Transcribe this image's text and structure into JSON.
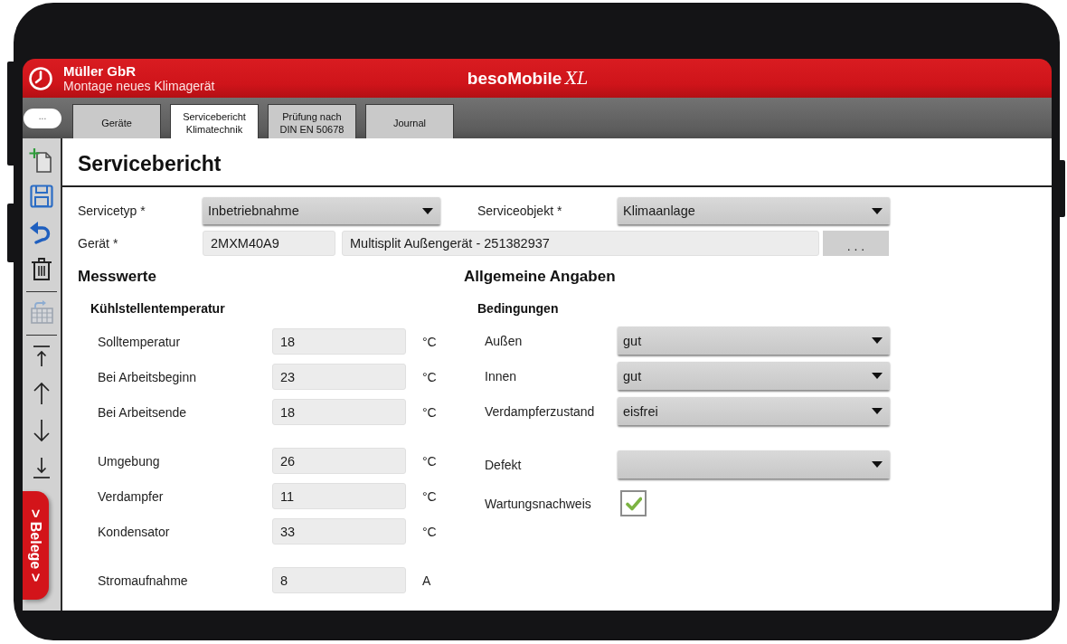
{
  "header": {
    "company": "Müller GbR",
    "subtitle": "Montage neues Klimagerät",
    "brand": "besoMobile",
    "brand_suffix": "XL"
  },
  "tab_bar": {
    "menu_button": "...",
    "tabs": [
      {
        "lines": [
          "Geräte"
        ],
        "selected": false
      },
      {
        "lines": [
          "Servicebericht",
          "Klimatechnik"
        ],
        "selected": true
      },
      {
        "lines": [
          "Prüfung nach",
          "DIN EN 50678"
        ],
        "selected": false
      },
      {
        "lines": [
          "Journal"
        ],
        "selected": false
      }
    ]
  },
  "toolbar": {
    "groups": [
      [
        {
          "kind": "new_document",
          "disabled": false
        },
        {
          "kind": "save",
          "disabled": false
        },
        {
          "kind": "undo",
          "disabled": false
        },
        {
          "kind": "delete",
          "disabled": false
        }
      ],
      [
        {
          "kind": "calendar",
          "disabled": true
        }
      ],
      [
        {
          "kind": "first",
          "disabled": false
        },
        {
          "kind": "up",
          "disabled": false
        },
        {
          "kind": "down",
          "disabled": false
        },
        {
          "kind": "last",
          "disabled": false
        }
      ]
    ]
  },
  "side_drawer": {
    "label": "> Belege >"
  },
  "form": {
    "title": "Servicebericht",
    "service_type": {
      "label": "Servicetyp *",
      "value": "Inbetriebnahme"
    },
    "service_object": {
      "label": "Serviceobjekt *",
      "value": "Klimaanlage"
    },
    "device": {
      "label": "Gerät *",
      "code": "2MXM40A9",
      "description": "Multisplit Außengerät - 251382937",
      "lookup_button": ". . ."
    }
  },
  "measurements": {
    "title": "Messwerte",
    "subtitle": "Kühlstellentemperatur",
    "groups": [
      {
        "rows": [
          {
            "label": "Solltemperatur",
            "value": "18",
            "unit": "°C"
          },
          {
            "label": "Bei Arbeitsbeginn",
            "value": "23",
            "unit": "°C"
          },
          {
            "label": "Bei Arbeitsende",
            "value": "18",
            "unit": "°C"
          }
        ]
      },
      {
        "rows": [
          {
            "label": "Umgebung",
            "value": "26",
            "unit": "°C"
          },
          {
            "label": "Verdampfer",
            "value": "11",
            "unit": "°C"
          },
          {
            "label": "Kondensator",
            "value": "33",
            "unit": "°C"
          }
        ]
      },
      {
        "rows": [
          {
            "label": "Stromaufnahme",
            "value": "8",
            "unit": "A"
          }
        ]
      }
    ]
  },
  "general": {
    "title": "Allgemeine Angaben",
    "subtitle": "Bedingungen",
    "groups": [
      {
        "rows": [
          {
            "kind": "dropdown",
            "label": "Außen",
            "value": "gut"
          },
          {
            "kind": "dropdown",
            "label": "Innen",
            "value": "gut"
          },
          {
            "kind": "dropdown",
            "label": "Verdampferzustand",
            "value": "eisfrei"
          }
        ]
      },
      {
        "rows": [
          {
            "kind": "dropdown",
            "label": "Defekt"
          },
          {
            "kind": "checkbox",
            "label": "Wartungsnachweis",
            "checked": true
          }
        ]
      }
    ]
  }
}
